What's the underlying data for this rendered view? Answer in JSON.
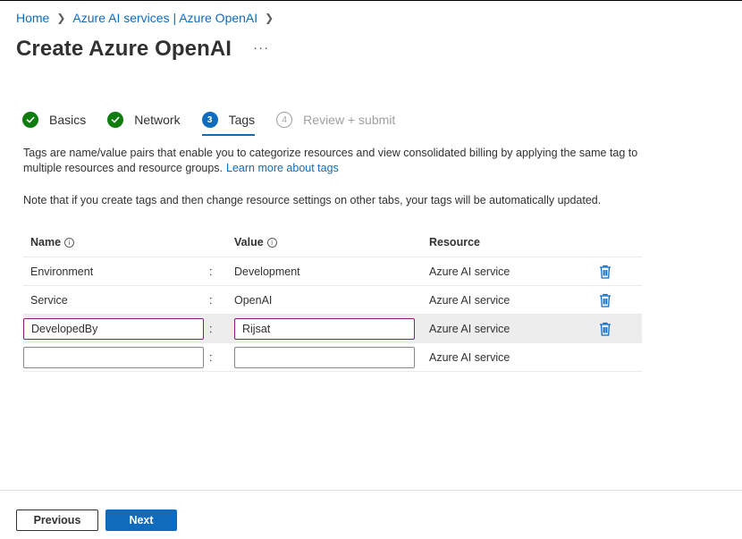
{
  "breadcrumb": {
    "items": [
      "Home",
      "Azure AI services | Azure OpenAI"
    ]
  },
  "header": {
    "title": "Create Azure OpenAI",
    "more_label": "···"
  },
  "tabs": [
    {
      "label": "Basics",
      "state": "done"
    },
    {
      "label": "Network",
      "state": "done"
    },
    {
      "label": "Tags",
      "state": "current",
      "number": "3"
    },
    {
      "label": "Review + submit",
      "state": "future",
      "number": "4"
    }
  ],
  "description": {
    "text": "Tags are name/value pairs that enable you to categorize resources and view consolidated billing by applying the same tag to multiple resources and resource groups.",
    "link": "Learn more about tags",
    "note": "Note that if you create tags and then change resource settings on other tabs, your tags will be automatically updated."
  },
  "table": {
    "headers": {
      "name": "Name",
      "value": "Value",
      "resource": "Resource",
      "info_glyph": "i"
    },
    "separator": ":",
    "rows": [
      {
        "name": "Environment",
        "value": "Development",
        "resource": "Azure AI service"
      },
      {
        "name": "Service",
        "value": "OpenAI",
        "resource": "Azure AI service"
      },
      {
        "name": "DevelopedBy",
        "value": "Rijsat",
        "resource": "Azure AI service"
      },
      {
        "name": "",
        "value": "",
        "resource": "Azure AI service"
      }
    ]
  },
  "footer": {
    "previous_label": "Previous",
    "next_label": "Next"
  },
  "colors": {
    "accent": "#0f6cbd",
    "success": "#107c10",
    "focus_border": "#8a1f7a"
  }
}
